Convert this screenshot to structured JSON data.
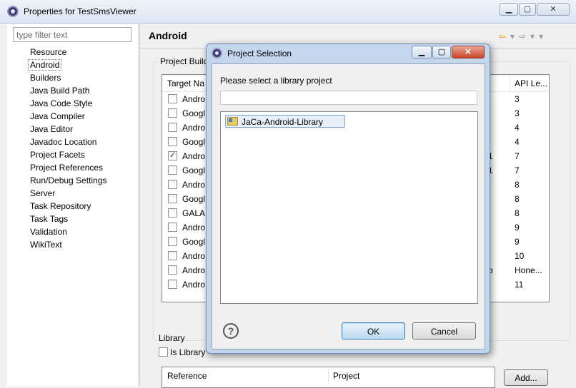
{
  "window": {
    "title": "Properties for TestSmsViewer",
    "minimize": "▁",
    "maximize": "▢",
    "close": "✕"
  },
  "sidebar": {
    "filter_placeholder": "type filter text",
    "items": [
      {
        "label": "Resource"
      },
      {
        "label": "Android"
      },
      {
        "label": "Builders"
      },
      {
        "label": "Java Build Path"
      },
      {
        "label": "Java Code Style"
      },
      {
        "label": "Java Compiler"
      },
      {
        "label": "Java Editor"
      },
      {
        "label": "Javadoc Location"
      },
      {
        "label": "Project Facets"
      },
      {
        "label": "Project References"
      },
      {
        "label": "Run/Debug Settings"
      },
      {
        "label": "Server"
      },
      {
        "label": "Task Repository"
      },
      {
        "label": "Task Tags"
      },
      {
        "label": "Validation"
      },
      {
        "label": "WikiText"
      }
    ],
    "selected": "Android"
  },
  "page": {
    "title": "Android",
    "build_group_label": "Project Build",
    "table": {
      "headers": {
        "target": "Target Na",
        "api": "API Le..."
      },
      "rows": [
        {
          "name": "Andro",
          "checked": false,
          "vendor": "",
          "api": "3"
        },
        {
          "name": "Googl",
          "checked": false,
          "vendor": "",
          "api": "3"
        },
        {
          "name": "Andro",
          "checked": false,
          "vendor": "",
          "api": "4"
        },
        {
          "name": "Googl",
          "checked": false,
          "vendor": "",
          "api": "4"
        },
        {
          "name": "Andro",
          "checked": true,
          "vendor": "te1",
          "api": "7"
        },
        {
          "name": "Googl",
          "checked": false,
          "vendor": "te1",
          "api": "7"
        },
        {
          "name": "Andro",
          "checked": false,
          "vendor": "",
          "api": "8"
        },
        {
          "name": "Googl",
          "checked": false,
          "vendor": "",
          "api": "8"
        },
        {
          "name": "GALA",
          "checked": false,
          "vendor": "",
          "api": "8"
        },
        {
          "name": "Andro",
          "checked": false,
          "vendor": "",
          "api": "9"
        },
        {
          "name": "Googl",
          "checked": false,
          "vendor": "",
          "api": "9"
        },
        {
          "name": "Andro",
          "checked": false,
          "vendor": "",
          "api": "10"
        },
        {
          "name": "Andro",
          "checked": false,
          "vendor": "mb",
          "api": "Hone..."
        },
        {
          "name": "Andro",
          "checked": false,
          "vendor": "",
          "api": "11"
        }
      ]
    },
    "library": {
      "label": "Library",
      "is_library_label": "Is Library",
      "headers": {
        "reference": "Reference",
        "project": "Project"
      },
      "add_button": "Add..."
    }
  },
  "dialog": {
    "title": "Project Selection",
    "prompt": "Please select a library project",
    "filter_value": "",
    "items": [
      {
        "label": "JaCa-Android-Library"
      }
    ],
    "ok": "OK",
    "cancel": "Cancel",
    "help": "?",
    "minimize": "▁",
    "maximize": "▢",
    "close": "✕"
  }
}
